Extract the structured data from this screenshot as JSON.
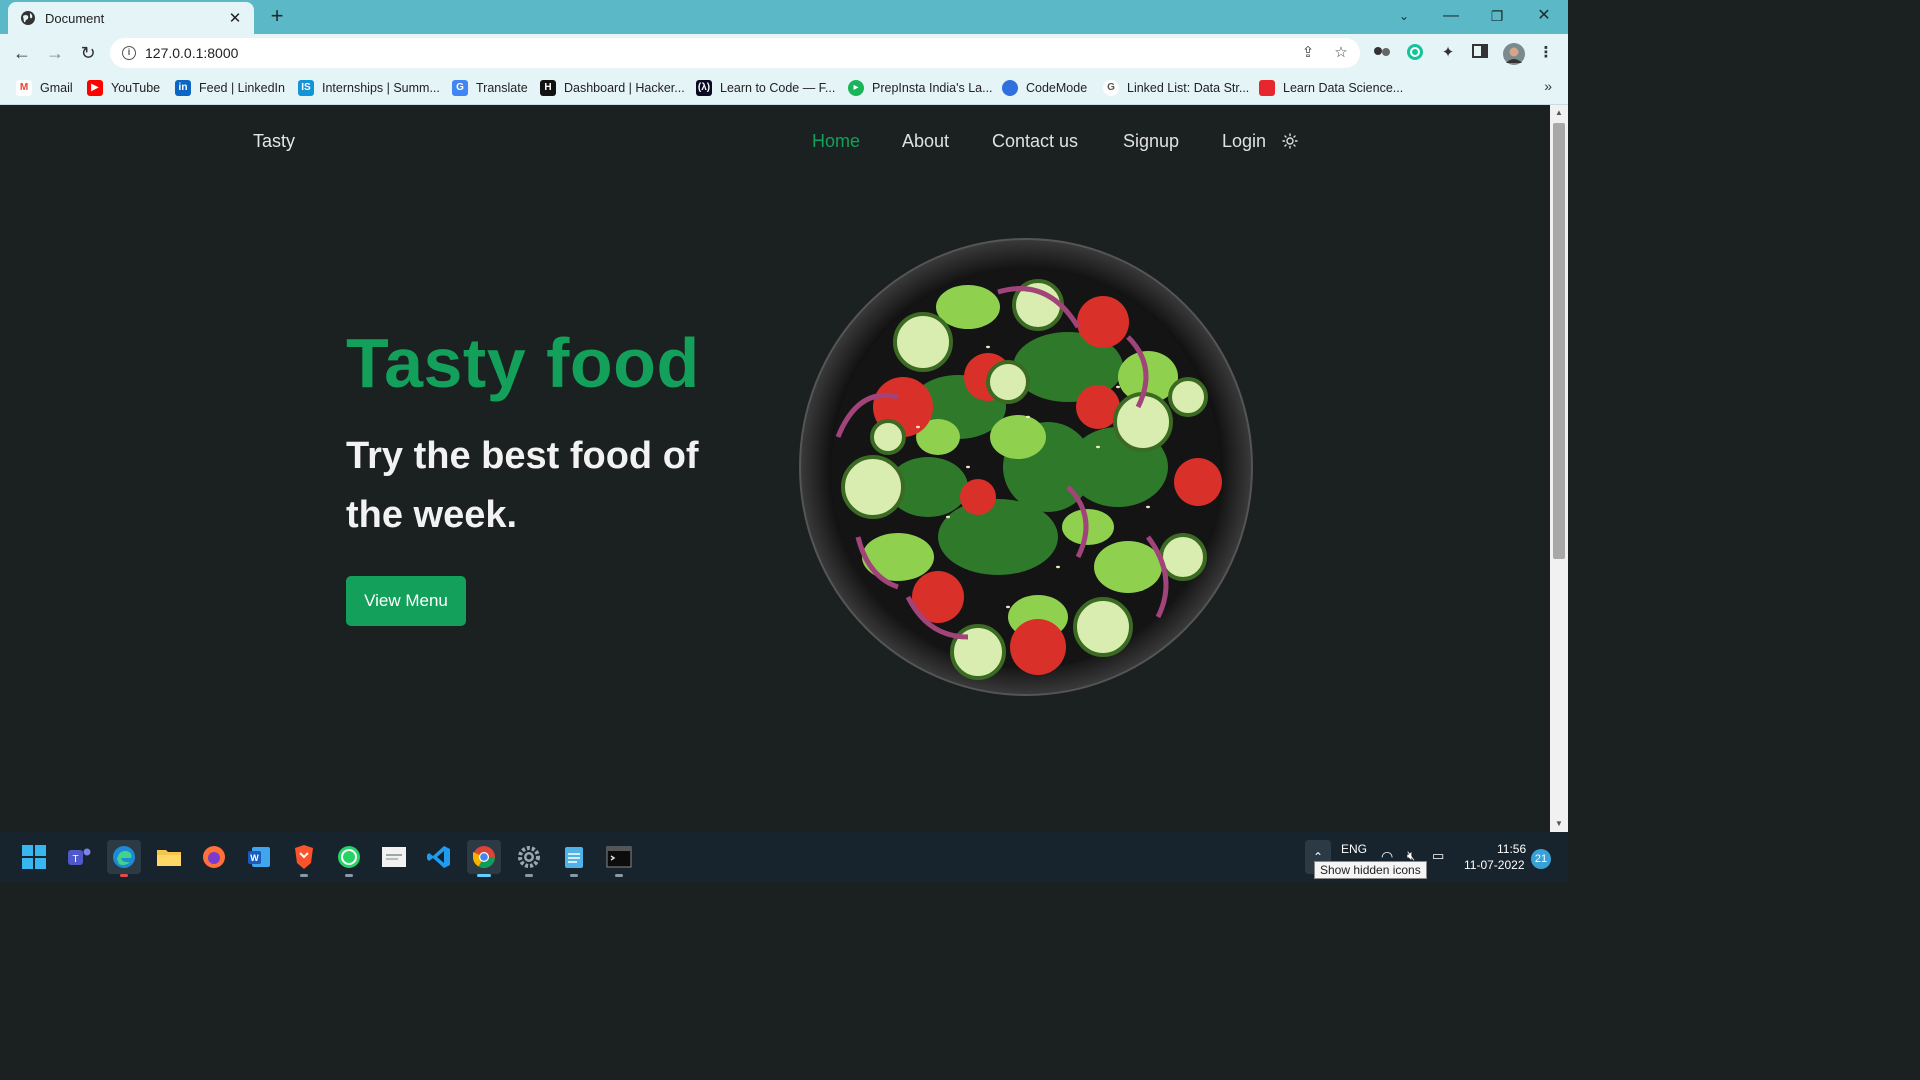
{
  "browser": {
    "tab_title": "Document",
    "url": "127.0.0.1:8000",
    "bookmarks": [
      {
        "label": "Gmail",
        "icon": "gmail-icon",
        "color": "#ea4335"
      },
      {
        "label": "YouTube",
        "icon": "youtube-icon",
        "color": "#ff0000"
      },
      {
        "label": "Feed | LinkedIn",
        "icon": "linkedin-icon",
        "color": "#0a66c2"
      },
      {
        "label": "Internships | Summ...",
        "icon": "internshala-icon",
        "color": "#1295d8"
      },
      {
        "label": "Translate",
        "icon": "translate-icon",
        "color": "#4285f4"
      },
      {
        "label": "Dashboard | Hacker...",
        "icon": "hackerrank-icon",
        "color": "#111111"
      },
      {
        "label": "Learn to Code — F...",
        "icon": "freecodecamp-icon",
        "color": "#0a0a23"
      },
      {
        "label": "PrepInsta India's La...",
        "icon": "prepinsta-icon",
        "color": "#19b55a"
      },
      {
        "label": "CodeMode",
        "icon": "codemode-icon",
        "color": "#2f6fe0"
      },
      {
        "label": "Linked List: Data Str...",
        "icon": "google-icon",
        "color": "#ffffff"
      },
      {
        "label": "Learn Data Science...",
        "icon": "datascience-icon",
        "color": "#e8262e"
      }
    ],
    "bookmarks_more": "»"
  },
  "site": {
    "brand": "Tasty",
    "nav": {
      "home": "Home",
      "about": "About",
      "contact": "Contact us",
      "signup": "Signup",
      "login": "Login"
    },
    "hero": {
      "title": "Tasty food",
      "subtitle": "Try the best food of the week.",
      "button": "View Menu"
    }
  },
  "colors": {
    "accent": "#13a05a",
    "background": "#1b2020",
    "chrome": "#5bb8c6"
  },
  "taskbar": {
    "language": "ENG",
    "time": "11:56",
    "date": "11-07-2022",
    "notifications": "21",
    "tooltip": "Show hidden icons",
    "apps": [
      "windows-start-icon",
      "teams-icon",
      "edge-icon",
      "file-explorer-icon",
      "firefox-icon",
      "word-icon",
      "brave-icon",
      "whatsapp-icon",
      "document-thumbnail-icon",
      "vscode-icon",
      "chrome-icon",
      "settings-icon",
      "notepad-icon",
      "terminal-icon"
    ]
  }
}
